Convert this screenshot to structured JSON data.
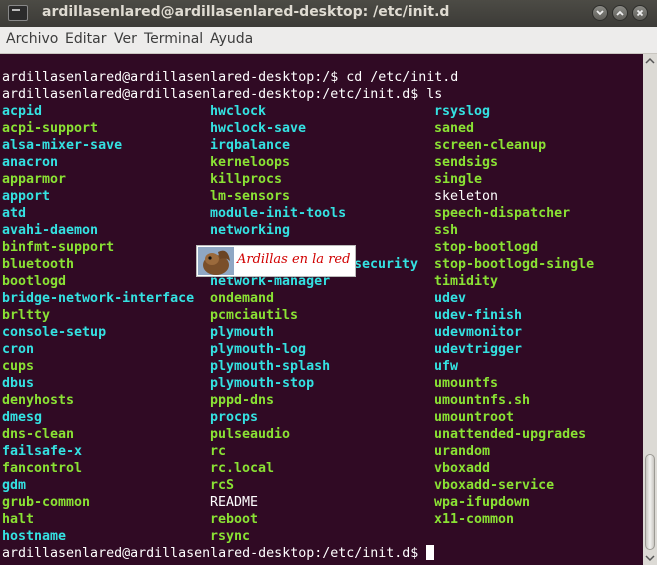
{
  "window": {
    "title": "ardillasenlared@ardillasenlared-desktop: /etc/init.d",
    "controls": [
      "minimize-icon",
      "maximize-icon",
      "close-icon"
    ]
  },
  "menu": [
    "Archivo",
    "Editar",
    "Ver",
    "Terminal",
    "Ayuda"
  ],
  "terminal": {
    "prompt_cd": "ardillasenlared@ardillasenlared-desktop:/$ cd /etc/init.d",
    "prompt_ls": "ardillasenlared@ardillasenlared-desktop:/etc/init.d$ ls",
    "prompt_final": "ardillasenlared@ardillasenlared-desktop:/etc/init.d$ ",
    "colors": {
      "background": "#300a24",
      "executable": "#8ae234",
      "symlink": "#34e2e2",
      "plain": "#ffffff"
    },
    "columns": [
      [
        {
          "name": "acpid",
          "type": "link"
        },
        {
          "name": "acpi-support",
          "type": "exec"
        },
        {
          "name": "alsa-mixer-save",
          "type": "link"
        },
        {
          "name": "anacron",
          "type": "link"
        },
        {
          "name": "apparmor",
          "type": "exec"
        },
        {
          "name": "apport",
          "type": "link"
        },
        {
          "name": "atd",
          "type": "link"
        },
        {
          "name": "avahi-daemon",
          "type": "link"
        },
        {
          "name": "binfmt-support",
          "type": "exec"
        },
        {
          "name": "bluetooth",
          "type": "exec"
        },
        {
          "name": "bootlogd",
          "type": "exec"
        },
        {
          "name": "bridge-network-interface",
          "type": "link"
        },
        {
          "name": "brltty",
          "type": "exec"
        },
        {
          "name": "console-setup",
          "type": "link"
        },
        {
          "name": "cron",
          "type": "link"
        },
        {
          "name": "cups",
          "type": "exec"
        },
        {
          "name": "dbus",
          "type": "link"
        },
        {
          "name": "denyhosts",
          "type": "exec"
        },
        {
          "name": "dmesg",
          "type": "link"
        },
        {
          "name": "dns-clean",
          "type": "exec"
        },
        {
          "name": "failsafe-x",
          "type": "link"
        },
        {
          "name": "fancontrol",
          "type": "exec"
        },
        {
          "name": "gdm",
          "type": "link"
        },
        {
          "name": "grub-common",
          "type": "exec"
        },
        {
          "name": "halt",
          "type": "exec"
        },
        {
          "name": "hostname",
          "type": "link"
        }
      ],
      [
        {
          "name": "hwclock",
          "type": "link"
        },
        {
          "name": "hwclock-save",
          "type": "link"
        },
        {
          "name": "irqbalance",
          "type": "link"
        },
        {
          "name": "kerneloops",
          "type": "exec"
        },
        {
          "name": "killprocs",
          "type": "exec"
        },
        {
          "name": "lm-sensors",
          "type": "exec"
        },
        {
          "name": "module-init-tools",
          "type": "link"
        },
        {
          "name": "networking",
          "type": "link"
        },
        {
          "name": "",
          "type": "exec"
        },
        {
          "name": "security",
          "type": "link"
        },
        {
          "name": "network-manager",
          "type": "link"
        },
        {
          "name": "ondemand",
          "type": "exec"
        },
        {
          "name": "pcmciautils",
          "type": "exec"
        },
        {
          "name": "plymouth",
          "type": "link"
        },
        {
          "name": "plymouth-log",
          "type": "link"
        },
        {
          "name": "plymouth-splash",
          "type": "link"
        },
        {
          "name": "plymouth-stop",
          "type": "link"
        },
        {
          "name": "pppd-dns",
          "type": "exec"
        },
        {
          "name": "procps",
          "type": "link"
        },
        {
          "name": "pulseaudio",
          "type": "exec"
        },
        {
          "name": "rc",
          "type": "exec"
        },
        {
          "name": "rc.local",
          "type": "exec"
        },
        {
          "name": "rcS",
          "type": "exec"
        },
        {
          "name": "README",
          "type": "plain"
        },
        {
          "name": "reboot",
          "type": "exec"
        },
        {
          "name": "rsync",
          "type": "exec"
        }
      ],
      [
        {
          "name": "rsyslog",
          "type": "link"
        },
        {
          "name": "saned",
          "type": "exec"
        },
        {
          "name": "screen-cleanup",
          "type": "exec"
        },
        {
          "name": "sendsigs",
          "type": "exec"
        },
        {
          "name": "single",
          "type": "exec"
        },
        {
          "name": "skeleton",
          "type": "plain"
        },
        {
          "name": "speech-dispatcher",
          "type": "exec"
        },
        {
          "name": "ssh",
          "type": "exec"
        },
        {
          "name": "stop-bootlogd",
          "type": "exec"
        },
        {
          "name": "stop-bootlogd-single",
          "type": "exec"
        },
        {
          "name": "timidity",
          "type": "exec"
        },
        {
          "name": "udev",
          "type": "link"
        },
        {
          "name": "udev-finish",
          "type": "link"
        },
        {
          "name": "udevmonitor",
          "type": "link"
        },
        {
          "name": "udevtrigger",
          "type": "link"
        },
        {
          "name": "ufw",
          "type": "link"
        },
        {
          "name": "umountfs",
          "type": "exec"
        },
        {
          "name": "umountnfs.sh",
          "type": "exec"
        },
        {
          "name": "umountroot",
          "type": "exec"
        },
        {
          "name": "unattended-upgrades",
          "type": "exec"
        },
        {
          "name": "urandom",
          "type": "exec"
        },
        {
          "name": "vboxadd",
          "type": "exec"
        },
        {
          "name": "vboxadd-service",
          "type": "exec"
        },
        {
          "name": "wpa-ifupdown",
          "type": "exec"
        },
        {
          "name": "x11-common",
          "type": "exec"
        }
      ]
    ]
  },
  "watermark": {
    "text": "Ardillas en la red",
    "icon": "squirrel-icon"
  }
}
